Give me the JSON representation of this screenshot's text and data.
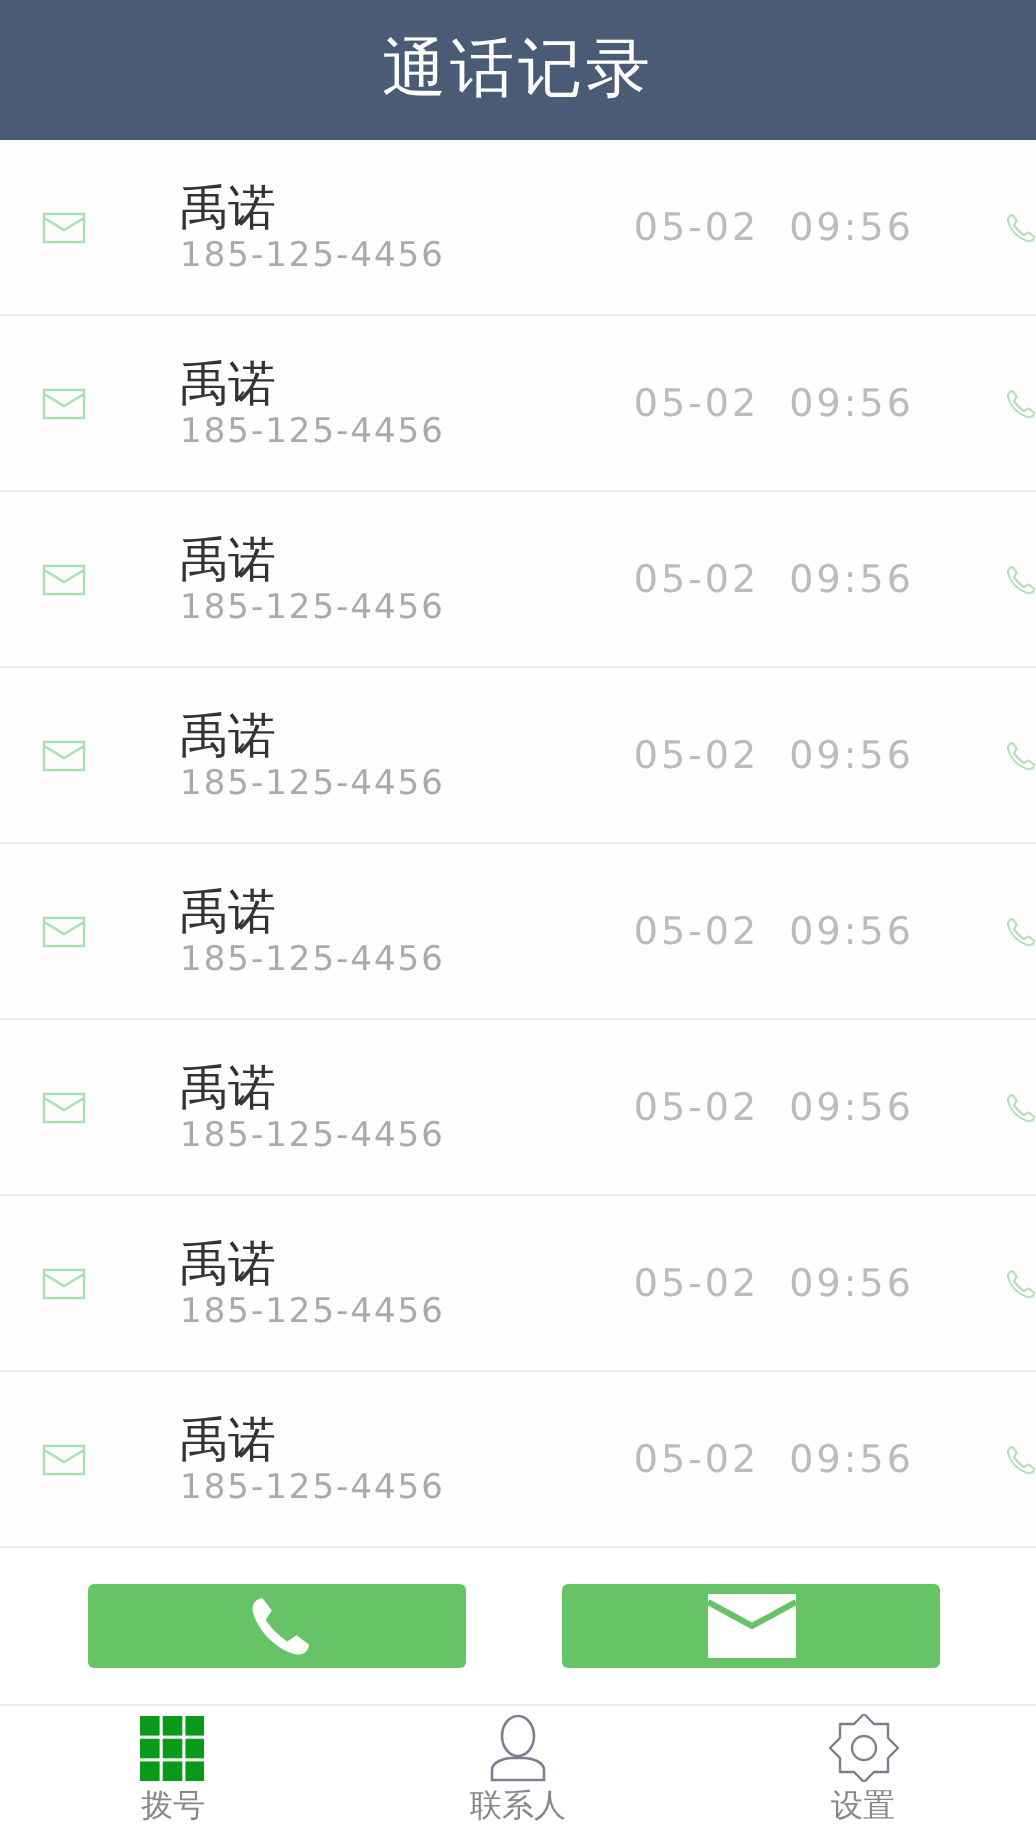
{
  "header": {
    "title": "通话记录"
  },
  "calls": [
    {
      "name": "禹诺",
      "number": "185-125-4456",
      "time": "05-02  09:56"
    },
    {
      "name": "禹诺",
      "number": "185-125-4456",
      "time": "05-02  09:56"
    },
    {
      "name": "禹诺",
      "number": "185-125-4456",
      "time": "05-02  09:56"
    },
    {
      "name": "禹诺",
      "number": "185-125-4456",
      "time": "05-02  09:56"
    },
    {
      "name": "禹诺",
      "number": "185-125-4456",
      "time": "05-02  09:56"
    },
    {
      "name": "禹诺",
      "number": "185-125-4456",
      "time": "05-02  09:56"
    },
    {
      "name": "禹诺",
      "number": "185-125-4456",
      "time": "05-02  09:56"
    },
    {
      "name": "禹诺",
      "number": "185-125-4456",
      "time": "05-02  09:56"
    }
  ],
  "actions": [
    {
      "kind": "call"
    },
    {
      "kind": "message"
    }
  ],
  "tabs": [
    {
      "label": "拨号",
      "kind": "dial",
      "selected": true
    },
    {
      "label": "联系人",
      "kind": "contacts",
      "selected": false
    },
    {
      "label": "设置",
      "kind": "settings",
      "selected": false
    }
  ]
}
